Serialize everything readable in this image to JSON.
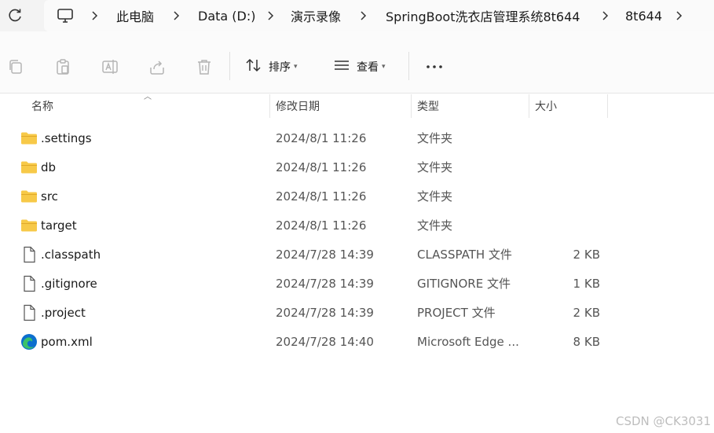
{
  "breadcrumb": {
    "items": [
      "此电脑",
      "Data (D:)",
      "演示录像",
      "SpringBoot洗衣店管理系统8t644",
      "8t644"
    ]
  },
  "toolbar": {
    "sort_label": "排序",
    "view_label": "查看"
  },
  "columns": {
    "name": "名称",
    "date": "修改日期",
    "type": "类型",
    "size": "大小"
  },
  "files": [
    {
      "name": ".settings",
      "date": "2024/8/1 11:26",
      "type": "文件夹",
      "size": "",
      "icon": "folder-icon"
    },
    {
      "name": "db",
      "date": "2024/8/1 11:26",
      "type": "文件夹",
      "size": "",
      "icon": "folder-icon"
    },
    {
      "name": "src",
      "date": "2024/8/1 11:26",
      "type": "文件夹",
      "size": "",
      "icon": "folder-icon"
    },
    {
      "name": "target",
      "date": "2024/8/1 11:26",
      "type": "文件夹",
      "size": "",
      "icon": "folder-icon"
    },
    {
      "name": ".classpath",
      "date": "2024/7/28 14:39",
      "type": "CLASSPATH 文件",
      "size": "2 KB",
      "icon": "file-icon"
    },
    {
      "name": ".gitignore",
      "date": "2024/7/28 14:39",
      "type": "GITIGNORE 文件",
      "size": "1 KB",
      "icon": "file-icon"
    },
    {
      "name": ".project",
      "date": "2024/7/28 14:39",
      "type": "PROJECT 文件",
      "size": "2 KB",
      "icon": "file-icon"
    },
    {
      "name": "pom.xml",
      "date": "2024/7/28 14:40",
      "type": "Microsoft Edge ...",
      "size": "8 KB",
      "icon": "edge-icon"
    }
  ],
  "watermark": "CSDN @CK3031",
  "colors": {
    "folder": "#f7c948",
    "edge_blue": "#0c6fce",
    "edge_green": "#3cc26b"
  }
}
